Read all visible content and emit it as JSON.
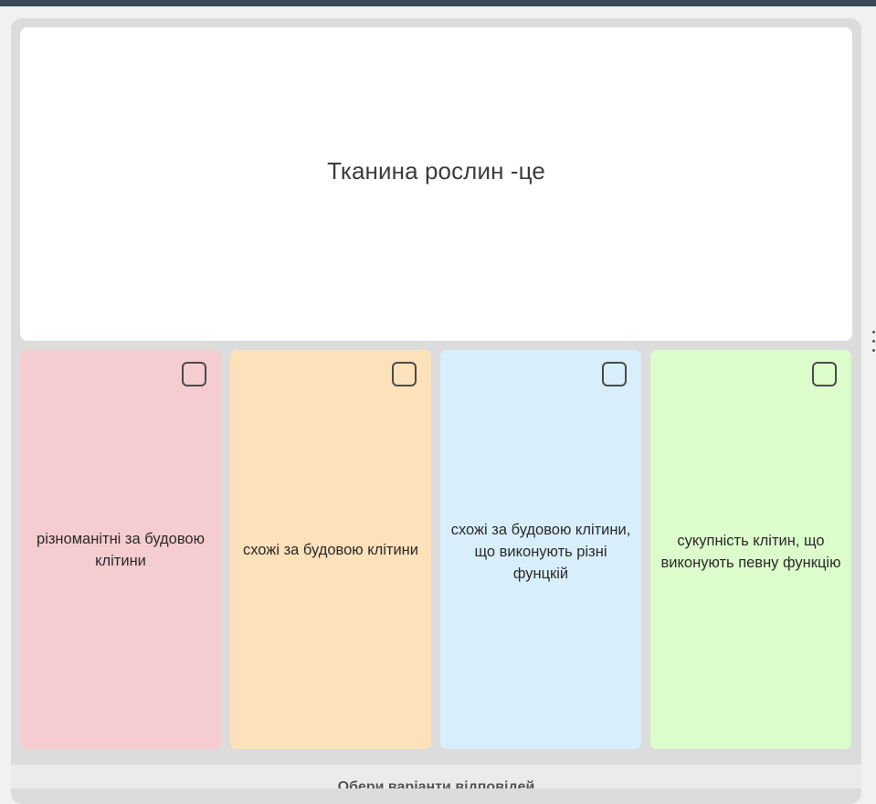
{
  "question": {
    "text": "Тканина рослин -це"
  },
  "answers": [
    {
      "label": "різноманітні за будовою клітини",
      "color": "#f5cccf",
      "checked": false
    },
    {
      "label": "схожі за будовою клітини",
      "color": "#fce1bb",
      "checked": false
    },
    {
      "label": "схожі за будовою клітини, що виконують різні фунцкій",
      "color": "#d8effb",
      "checked": false
    },
    {
      "label": "сукупність клітин, що виконують певну функцію",
      "color": "#dcfccc",
      "checked": false
    }
  ],
  "footer": {
    "label": "Обери варіанти відповідей"
  },
  "colors": {
    "top_bar": "#3b4a58",
    "frame": "#dcdcdc"
  }
}
